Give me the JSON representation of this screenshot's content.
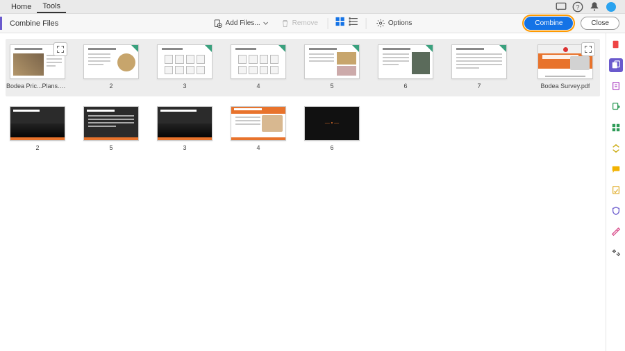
{
  "menubar": {
    "tabs": [
      {
        "label": "Home",
        "active": false
      },
      {
        "label": "Tools",
        "active": true
      }
    ]
  },
  "toolbar": {
    "title": "Combine Files",
    "add_files_label": "Add Files...",
    "remove_label": "Remove",
    "options_label": "Options",
    "combine_label": "Combine",
    "close_label": "Close"
  },
  "group1_caption": "Bodea Pric...Plans.pptx",
  "group1_pages": [
    "2",
    "3",
    "4",
    "5",
    "6",
    "7"
  ],
  "group2_caption": "Bodea Survey.pdf",
  "row2_pages": [
    "2",
    "5",
    "3",
    "4",
    "6"
  ],
  "sidebar_tools": [
    {
      "name": "create-pdf-icon",
      "color": "#e44"
    },
    {
      "name": "combine-files-icon",
      "color": "#fff",
      "active": true
    },
    {
      "name": "edit-pdf-icon",
      "color": "#b14fc6"
    },
    {
      "name": "export-pdf-icon",
      "color": "#2e9b57"
    },
    {
      "name": "organize-icon",
      "color": "#2e9b57"
    },
    {
      "name": "compress-icon",
      "color": "#c7a500"
    },
    {
      "name": "comment-icon",
      "color": "#f2b200"
    },
    {
      "name": "fill-sign-icon",
      "color": "#e2b33a"
    },
    {
      "name": "protect-icon",
      "color": "#6a5acd"
    },
    {
      "name": "redact-icon",
      "color": "#d94f8c"
    },
    {
      "name": "more-tools-icon",
      "color": "#555"
    }
  ]
}
